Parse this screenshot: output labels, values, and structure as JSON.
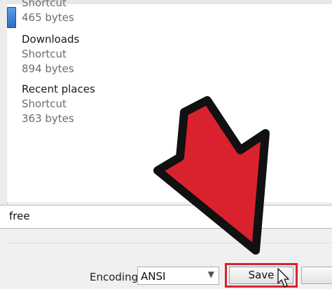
{
  "file_list": {
    "items": [
      {
        "name": "Shortcut",
        "type": "",
        "size": "465 bytes",
        "partial": true
      },
      {
        "name": "Downloads",
        "type": "Shortcut",
        "size": "894 bytes"
      },
      {
        "name": "Recent places",
        "type": "Shortcut",
        "size": "363 bytes"
      }
    ]
  },
  "filename": {
    "value": "free"
  },
  "encoding": {
    "label": "Encoding:",
    "selected": "ANSI"
  },
  "buttons": {
    "save_label": "Save"
  },
  "annotation": {
    "arrow_color": "#d9222e",
    "highlight_color": "#d9222e",
    "icons": [
      "red-arrow-icon",
      "mouse-cursor-icon"
    ]
  }
}
